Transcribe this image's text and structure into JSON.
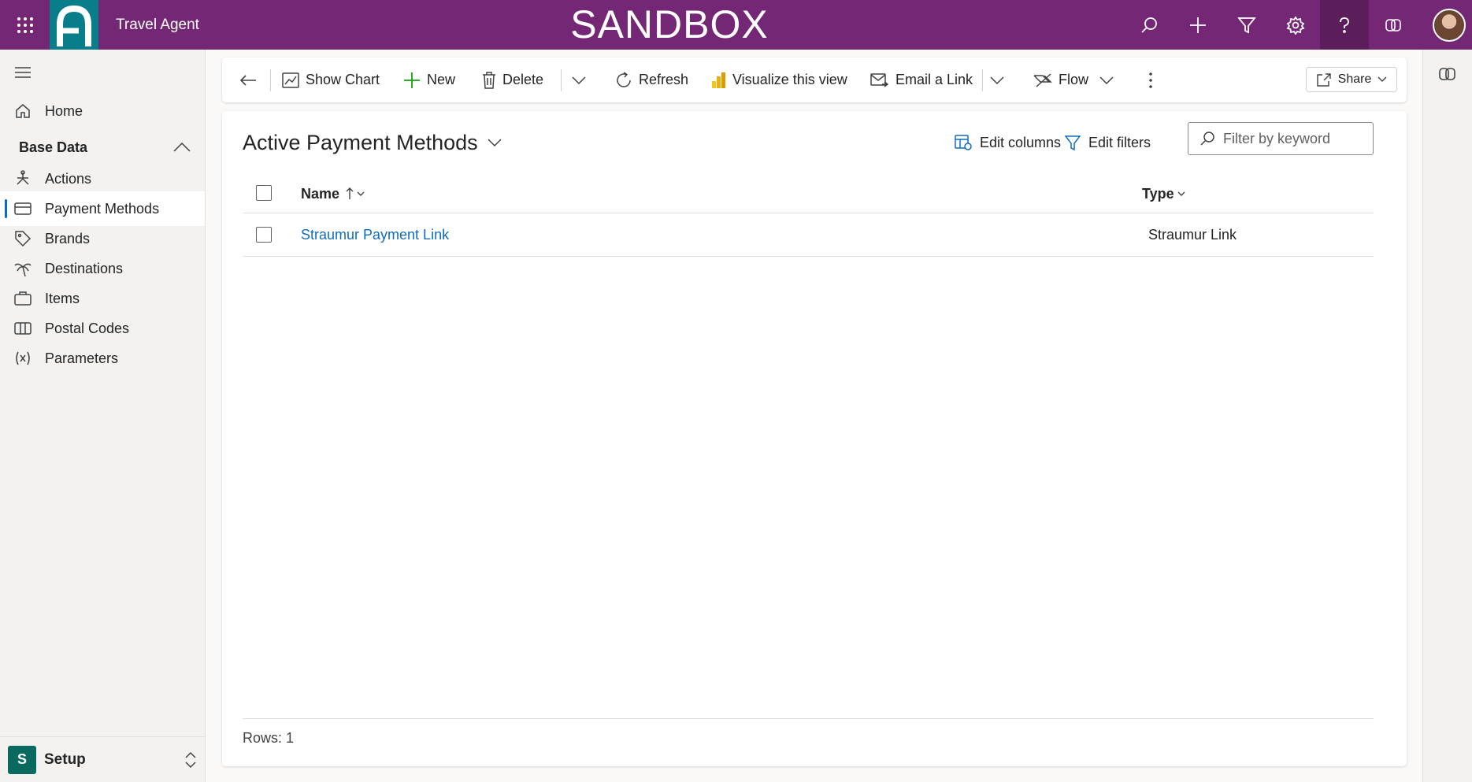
{
  "topbar": {
    "app_title": "Travel Agent",
    "environment": "SANDBOX",
    "icons": [
      "waffle-icon",
      "search-icon",
      "add-icon",
      "filter-icon",
      "settings-icon",
      "help-icon",
      "copilot-icon"
    ],
    "bg_color": "#742774",
    "logo_color": "#087e8b"
  },
  "sidebar": {
    "home_label": "Home",
    "group_label": "Base Data",
    "items": [
      {
        "label": "Actions",
        "icon": "actions-icon"
      },
      {
        "label": "Payment Methods",
        "icon": "card-icon",
        "selected": true
      },
      {
        "label": "Brands",
        "icon": "tag-icon"
      },
      {
        "label": "Destinations",
        "icon": "palm-tree-icon"
      },
      {
        "label": "Items",
        "icon": "briefcase-icon"
      },
      {
        "label": "Postal Codes",
        "icon": "map-icon"
      },
      {
        "label": "Parameters",
        "icon": "variable-icon"
      }
    ],
    "area": {
      "badge": "S",
      "label": "Setup"
    }
  },
  "commandbar": {
    "show_chart": "Show Chart",
    "new": "New",
    "delete": "Delete",
    "refresh": "Refresh",
    "visualize": "Visualize this view",
    "email_link": "Email a Link",
    "flow": "Flow",
    "share": "Share"
  },
  "view": {
    "title": "Active Payment Methods",
    "edit_columns": "Edit columns",
    "edit_filters": "Edit filters",
    "filter_placeholder": "Filter by keyword",
    "columns": {
      "name": "Name",
      "type": "Type"
    },
    "rows": [
      {
        "name": "Straumur Payment Link",
        "type": "Straumur Link"
      }
    ],
    "rows_count": "Rows: 1"
  }
}
